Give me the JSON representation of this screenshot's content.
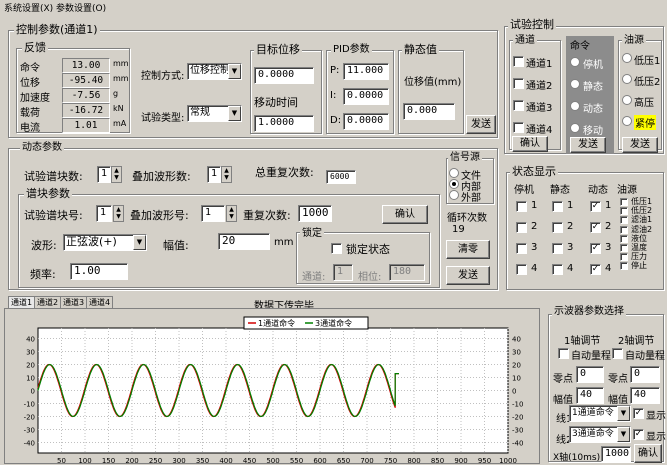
{
  "menu": {
    "items": [
      "系统设置(X)",
      "参数设置(O)"
    ]
  },
  "control_params": {
    "title": "控制参数(通道1)",
    "feedback": {
      "title": "反馈",
      "rows": [
        {
          "label": "命令",
          "value": "13.00",
          "unit": "mm"
        },
        {
          "label": "位移",
          "value": "-95.40",
          "unit": "mm"
        },
        {
          "label": "加速度",
          "value": "-7.56",
          "unit": "g"
        },
        {
          "label": "载荷",
          "value": "-16.72",
          "unit": "kN"
        },
        {
          "label": "电流",
          "value": "1.01",
          "unit": "mA"
        }
      ]
    },
    "control_mode_label": "控制方式:",
    "control_mode_value": "位移控制",
    "test_type_label": "试验类型:",
    "test_type_value": "常规",
    "target_pos_title": "目标位移",
    "target_pos_value": "0.0000",
    "move_time_title": "移动时间",
    "move_time_value": "1.0000",
    "pid_title": "PID参数",
    "pid": [
      {
        "label": "P:",
        "value": "11.000"
      },
      {
        "label": "I:",
        "value": "0.0000"
      },
      {
        "label": "D:",
        "value": "0.0000"
      }
    ],
    "static_title": "静态值",
    "static_label": "位移值(mm)",
    "static_value": "0.000",
    "send_label": "发送"
  },
  "dynamic_params": {
    "title": "动态参数",
    "spectrum_count_label": "试验谱块数:",
    "spectrum_count": "1",
    "overlay_count_label": "叠加波形数:",
    "overlay_count": "1",
    "total_repeat_label": "总重复次数:",
    "total_repeat": "6000",
    "spectrum_title": "谱块参数",
    "spectrum_no_label": "试验谱块号:",
    "spectrum_no": "1",
    "overlay_no_label": "叠加波形号:",
    "overlay_no": "1",
    "repeat_label": "重复次数:",
    "repeat_value": "1000",
    "confirm_label": "确认",
    "waveform_label": "波形:",
    "waveform_value": "正弦波(+)",
    "amplitude_label": "幅值:",
    "amplitude_value": "20",
    "amplitude_unit": "mm",
    "freq_label": "频率:",
    "freq_value": "1.00",
    "lock_title": "锁定",
    "lock_state_label": "锁定状态",
    "lock_channel_label": "通道:",
    "lock_channel_value": "1",
    "lock_phase_label": "相位:",
    "lock_phase_value": "180",
    "signal_title": "信号源",
    "signal_options": [
      "文件",
      "内部",
      "外部"
    ],
    "cycle_label": "循环次数",
    "cycle_value": "19",
    "clear_label": "清零",
    "send_label": "发送"
  },
  "test_control": {
    "title": "试验控制",
    "channel_title": "通道",
    "channels": [
      "通道1",
      "通道2",
      "通道3",
      "通道4"
    ],
    "channel_confirm": "确认",
    "command_title": "命令",
    "commands": [
      "停机",
      "静态",
      "动态",
      "移动"
    ],
    "command_send": "发送",
    "oil_title": "油源",
    "oil_options": [
      "低压1",
      "低压2",
      "高压",
      "紧停"
    ],
    "oil_send": "发送"
  },
  "status_display": {
    "title": "状态显示",
    "columns": [
      "停机",
      "静态",
      "动态",
      "油源"
    ],
    "rows": [
      "1",
      "2",
      "3",
      "4"
    ],
    "dynamic_checked": [
      true,
      true,
      true,
      true
    ],
    "oil_items": [
      "低压1",
      "低压2",
      "滤油1",
      "滤油2",
      "液位",
      "温度",
      "压力",
      "停止"
    ]
  },
  "tabs": [
    "通道1",
    "通道2",
    "通道3",
    "通道4"
  ],
  "status_msg": "数据下传完毕",
  "chart_data": {
    "type": "line",
    "legend_position": "top-center",
    "series": [
      {
        "name": "1通道命令",
        "color": "#d00000"
      },
      {
        "name": "3通道命令",
        "color": "#008000"
      }
    ],
    "x_ticks": [
      50,
      100,
      150,
      200,
      250,
      300,
      350,
      400,
      450,
      500,
      550,
      600,
      650,
      700,
      750,
      800,
      850,
      900,
      950,
      1000
    ],
    "y_ticks": [
      40,
      30,
      20,
      10,
      0,
      -10,
      -20,
      -30,
      -40
    ],
    "xlim": [
      0,
      1000
    ],
    "ylim": [
      -45,
      45
    ],
    "wave": {
      "amplitude": 20,
      "cycles_per_100": 1,
      "start": 0,
      "end": 760,
      "final_value": 13
    },
    "grid": true
  },
  "oscilloscope": {
    "title": "示波器参数选择",
    "axis1_title": "1轴调节",
    "axis2_title": "2轴调节",
    "auto_range_label": "自动量程",
    "zero_label": "零点",
    "zero1": "0",
    "zero2": "0",
    "amp_label": "幅值",
    "amp1": "40",
    "amp2": "40",
    "line1_label": "线1",
    "line1_value": "1通道命令",
    "line2_label": "线2",
    "line2_value": "3通道命令",
    "show_label": "显示",
    "xaxis_label": "X轴(10ms)",
    "xaxis_value": "1000",
    "confirm_label": "确认"
  }
}
